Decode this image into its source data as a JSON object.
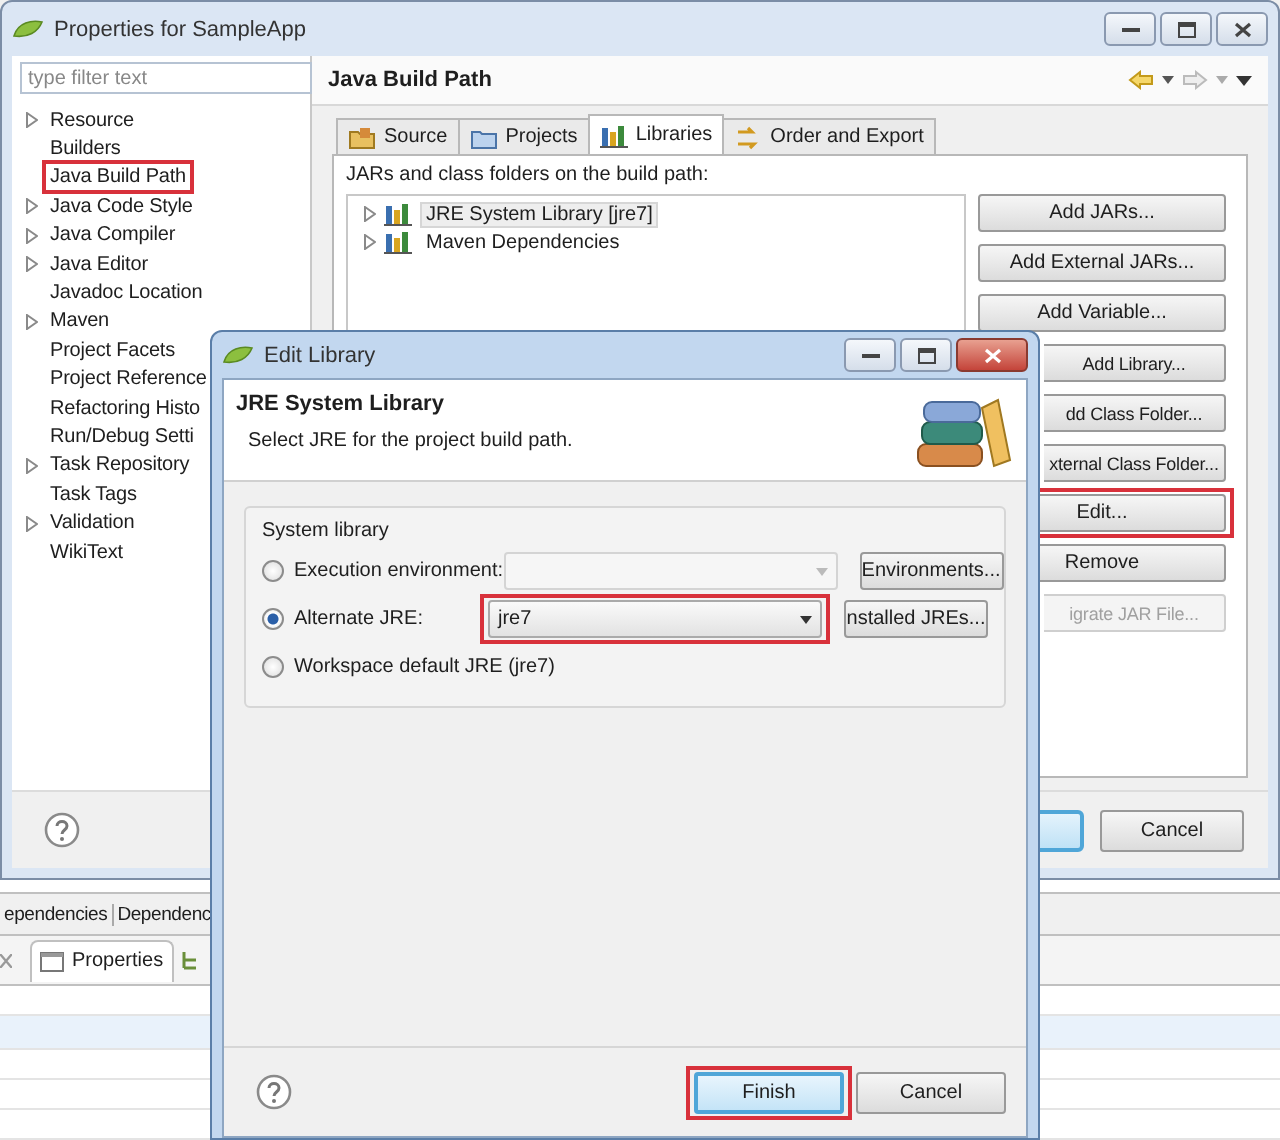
{
  "window": {
    "title": "Properties for SampleApp"
  },
  "filter": {
    "placeholder": "type filter text"
  },
  "nav": [
    {
      "label": "Resource",
      "expandable": true,
      "highlighted": false
    },
    {
      "label": "Builders",
      "expandable": false,
      "highlighted": false
    },
    {
      "label": "Java Build Path",
      "expandable": false,
      "highlighted": true
    },
    {
      "label": "Java Code Style",
      "expandable": true,
      "highlighted": false
    },
    {
      "label": "Java Compiler",
      "expandable": true,
      "highlighted": false
    },
    {
      "label": "Java Editor",
      "expandable": true,
      "highlighted": false
    },
    {
      "label": "Javadoc Location",
      "expandable": false,
      "highlighted": false
    },
    {
      "label": "Maven",
      "expandable": true,
      "highlighted": false
    },
    {
      "label": "Project Facets",
      "expandable": false,
      "highlighted": false
    },
    {
      "label": "Project Reference",
      "expandable": false,
      "highlighted": false
    },
    {
      "label": "Refactoring Histo",
      "expandable": false,
      "highlighted": false
    },
    {
      "label": "Run/Debug Setti",
      "expandable": false,
      "highlighted": false
    },
    {
      "label": "Task Repository",
      "expandable": true,
      "highlighted": false
    },
    {
      "label": "Task Tags",
      "expandable": false,
      "highlighted": false
    },
    {
      "label": "Validation",
      "expandable": true,
      "highlighted": false
    },
    {
      "label": "WikiText",
      "expandable": false,
      "highlighted": false
    }
  ],
  "page": {
    "title": "Java Build Path",
    "tabs": [
      {
        "label": "Source",
        "kind": "source",
        "selected": false
      },
      {
        "label": "Projects",
        "kind": "projects",
        "selected": false
      },
      {
        "label": "Libraries",
        "kind": "libraries",
        "selected": true
      },
      {
        "label": "Order and Export",
        "kind": "order",
        "selected": false
      }
    ],
    "caption": "JARs and class folders on the build path:",
    "libraries": [
      {
        "label": "JRE System Library [jre7]",
        "selected": true
      },
      {
        "label": "Maven Dependencies",
        "selected": false
      }
    ],
    "buttons": [
      {
        "label": "Add JARs...",
        "disabled": false,
        "cut": false,
        "highlighted": false
      },
      {
        "label": "Add External JARs...",
        "disabled": false,
        "cut": false,
        "highlighted": false
      },
      {
        "label": "Add Variable...",
        "disabled": false,
        "cut": false,
        "highlighted": false
      },
      {
        "label": "Add Library...",
        "disabled": false,
        "cut": true,
        "highlighted": false
      },
      {
        "label": "dd Class Folder...",
        "disabled": false,
        "cut": true,
        "highlighted": false
      },
      {
        "label": "xternal Class Folder...",
        "disabled": false,
        "cut": true,
        "highlighted": false
      },
      {
        "label": "Edit...",
        "disabled": false,
        "cut": false,
        "highlighted": true
      },
      {
        "label": "Remove",
        "disabled": false,
        "cut": false,
        "highlighted": false
      },
      {
        "label": "igrate JAR File...",
        "disabled": true,
        "cut": true,
        "highlighted": false
      }
    ]
  },
  "footer_buttons": [
    {
      "kind": "default"
    },
    {
      "kind": "normal",
      "label": "Cancel"
    }
  ],
  "views": {
    "top_tabs": [
      "ependencies",
      "Dependenc"
    ],
    "tabs": [
      {
        "label": "Properties"
      }
    ]
  },
  "dialog": {
    "title": "Edit Library",
    "heading": "JRE System Library",
    "description": "Select JRE for the project build path.",
    "group": "System library",
    "options": [
      {
        "label": "Execution environment:",
        "selected": false,
        "combo": {
          "disabled": true,
          "highlighted": false
        },
        "button": "Environments..."
      },
      {
        "label": "Alternate JRE:",
        "selected": true,
        "combo": {
          "value": "jre7",
          "disabled": false,
          "highlighted": true
        },
        "button": "nstalled JREs..."
      },
      {
        "label": "Workspace default JRE (jre7)",
        "selected": false
      }
    ],
    "buttons": [
      {
        "label": "Finish",
        "kind": "default",
        "highlighted": true
      },
      {
        "label": "Cancel",
        "kind": "normal",
        "highlighted": false
      }
    ]
  }
}
